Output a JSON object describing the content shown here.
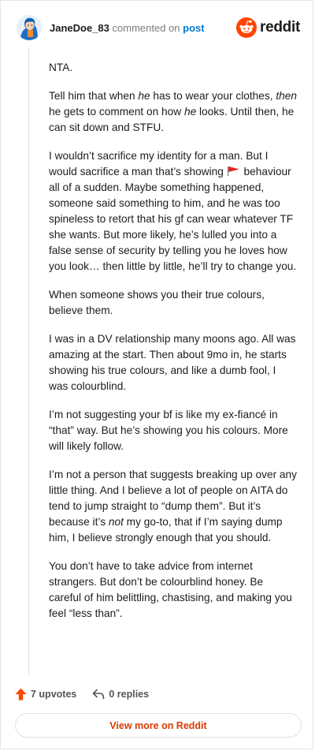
{
  "header": {
    "username": "JaneDoe_83",
    "commented_on": "commented on",
    "post_link": "post",
    "brand": "reddit"
  },
  "comment": {
    "p1": "NTA.",
    "p2": [
      "Tell him that when ",
      "he",
      " has to wear your clothes, ",
      "then",
      " he gets to comment on how ",
      "he",
      " looks. Until then, he can sit down and STFU."
    ],
    "p3": [
      "I wouldn’t sacrifice my identity for a man. But I would sacrifice a man that’s showing ",
      " behaviour all of a sudden. Maybe something happened, someone said something to him, and he was too spineless to retort that his gf can wear whatever TF she wants. But more likely, he’s lulled you into a false sense of security by telling you he loves how you look… then little by little, he’ll try to change you."
    ],
    "p4": "When someone shows you their true colours, believe them.",
    "p5": "I was in a DV relationship many moons ago. All was amazing at the start. Then about 9mo in, he starts showing his true colours, and like a dumb fool, I was colourblind.",
    "p6": "I’m not suggesting your bf is like my ex-fiancé in “that” way. But he’s showing you his colours. More will likely follow.",
    "p7": [
      "I’m not a person that suggests breaking up over any little thing. And I believe a lot of people on AITA do tend to jump straight to “dump them”. But it’s because it’s ",
      "not",
      " my go-to, that if I’m saying dump him, I believe strongly enough that you should."
    ],
    "p8": "You don’t have to take advice from internet strangers. But don’t be colourblind honey. Be careful of him belittling, chastising, and making you feel “less than”."
  },
  "actions": {
    "upvotes": "7 upvotes",
    "replies": "0 replies"
  },
  "footer": {
    "view_more": "View more on Reddit"
  },
  "icons": {
    "brand": "reddit-logo-icon",
    "flag": "red-flag-icon",
    "upvote": "upvote-arrow-icon",
    "reply": "reply-arrow-icon"
  },
  "colors": {
    "reddit_orange": "#ff4500",
    "link_blue": "#0079d3",
    "view_more": "#d93a00"
  }
}
